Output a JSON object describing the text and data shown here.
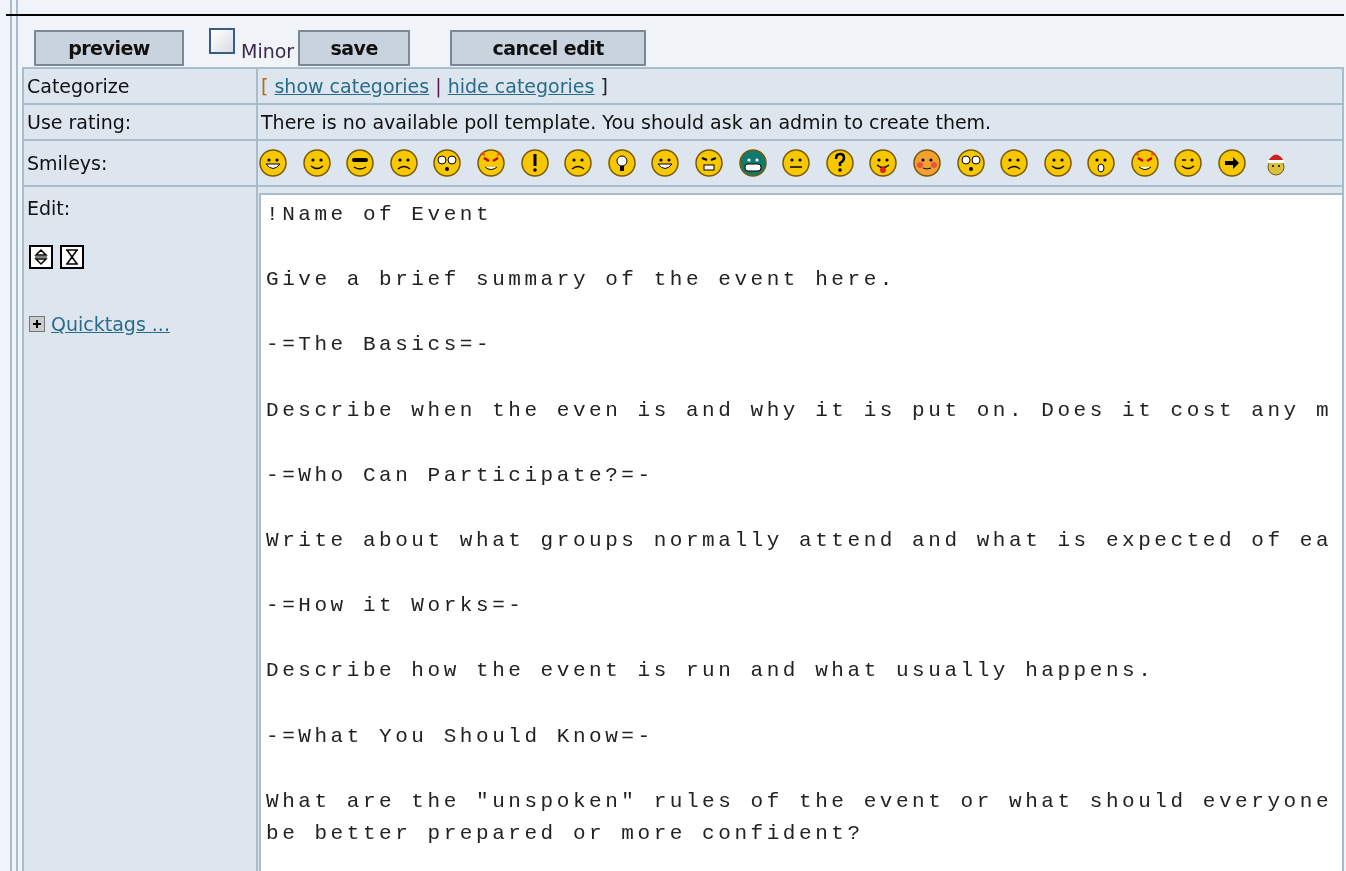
{
  "toolbar": [
    {
      "kind": "button",
      "label": "preview"
    },
    {
      "kind": "checkbox",
      "label": "Minor",
      "checked": false
    },
    {
      "kind": "button",
      "label": "save"
    },
    {
      "kind": "button",
      "label": "cancel edit"
    }
  ],
  "categorize": {
    "label": "Categorize",
    "open_bracket": "[",
    "links": [
      "show categories",
      "hide categories"
    ],
    "separator": "|",
    "close_bracket": "]"
  },
  "rating": {
    "label": "Use rating:",
    "message": "There is no available poll template. You should ask an admin to create them."
  },
  "smileys": {
    "label": "Smileys:"
  },
  "edit": {
    "label": "Edit:",
    "quicktags": {
      "label": "Quicktags ...",
      "expanded": false
    },
    "text": "!Name of Event\n\nGive a brief summary of the event here.\n\n-=The Basics=-\n\nDescribe when the even is and why it is put on. Does it cost any m\n\n-=Who Can Participate?=-\n\nWrite about what groups normally attend and what is expected of ea\n\n-=How it Works=-\n\nDescribe how the event is run and what usually happens.\n\n-=What You Should Know=-\n\nWhat are the \"unspoken\" rules of the event or what should everyone\nbe better prepared or more confident?"
  }
}
